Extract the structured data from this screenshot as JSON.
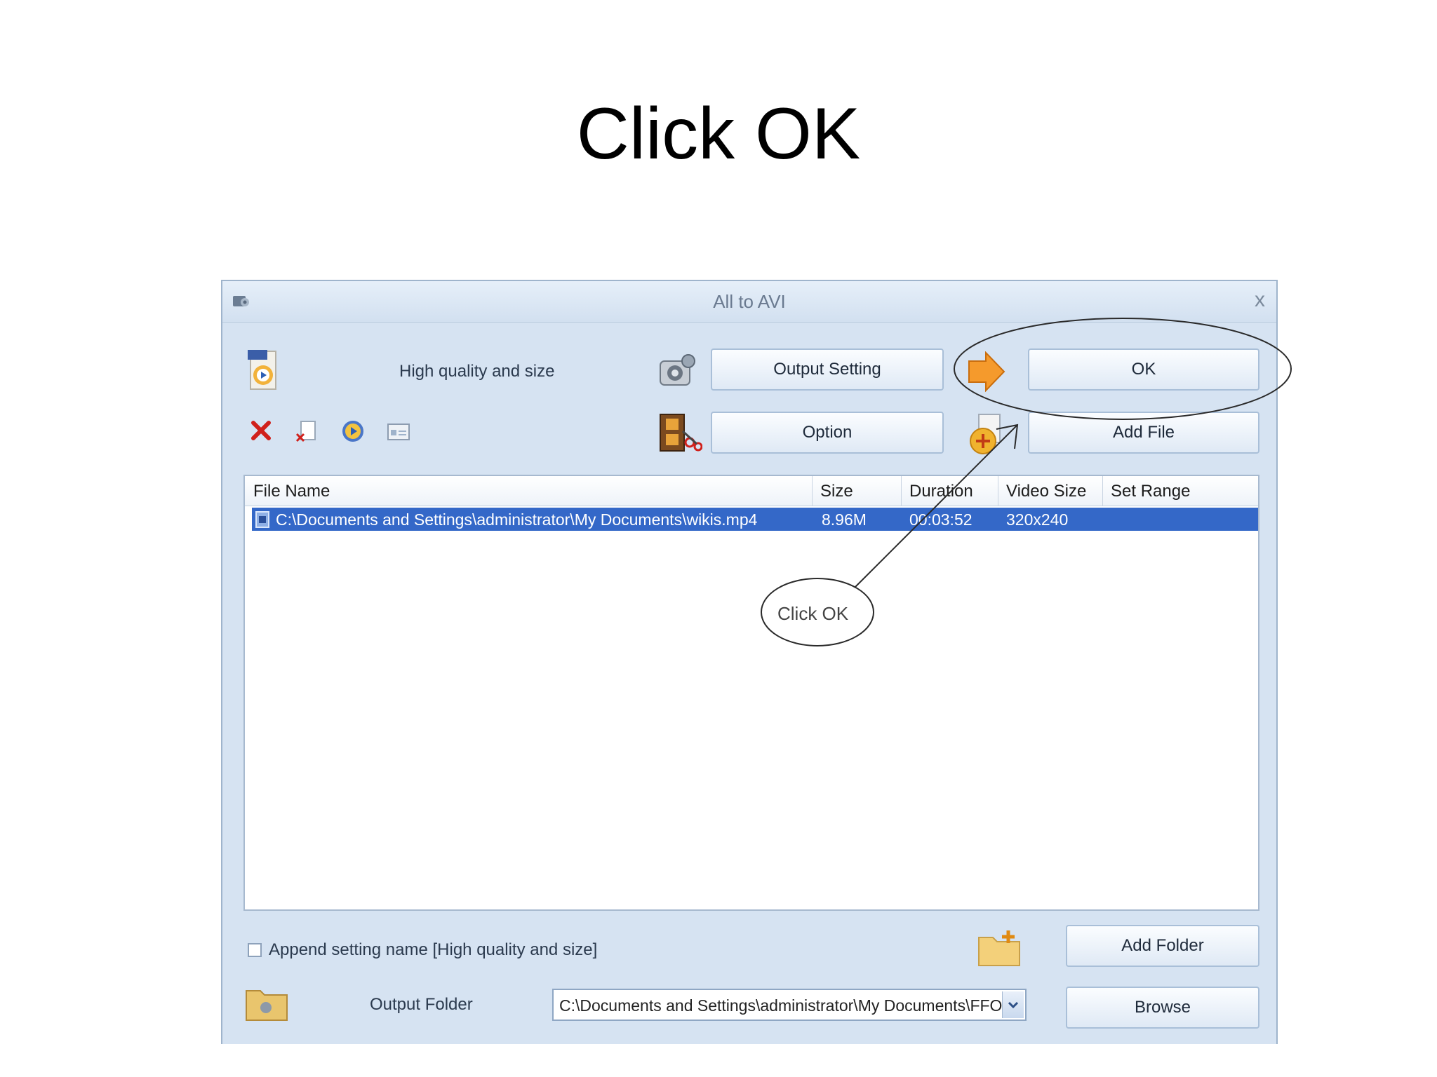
{
  "slide": {
    "title": "Click OK"
  },
  "window": {
    "title": "All to AVI",
    "close_symbol": "x",
    "icon": "app-icon"
  },
  "toolbar": {
    "profile_label": "High quality and size",
    "output_setting_label": "Output Setting",
    "ok_label": "OK",
    "option_label": "Option",
    "add_file_label": "Add File",
    "icons": [
      "avi-profile-icon",
      "delete-icon",
      "remove-file-icon",
      "play-icon",
      "properties-icon",
      "output-setting-icon",
      "film-cut-icon",
      "go-arrow-icon",
      "add-file-icon"
    ]
  },
  "file_list": {
    "columns": [
      "File Name",
      "Size",
      "Duration",
      "Video Size",
      "Set Range"
    ],
    "rows": [
      {
        "file_name": "C:\\Documents and Settings\\administrator\\My Documents\\wikis.mp4",
        "size": "8.96M",
        "duration": "00:03:52",
        "video_size": "320x240",
        "set_range": ""
      }
    ]
  },
  "footer": {
    "append_setting_label": "Append setting name [High quality and size]",
    "append_setting_checked": false,
    "add_folder_label": "Add Folder",
    "output_folder_label": "Output Folder",
    "output_folder_value": "C:\\Documents and Settings\\administrator\\My Documents\\FFO",
    "browse_label": "Browse"
  },
  "annotation": {
    "callout_text": "Click OK",
    "colors": {
      "line": "#333333"
    }
  },
  "colors": {
    "selection": "#3468c8",
    "window_bg": "#d6e3f2",
    "button_border": "#a9bfd8"
  }
}
